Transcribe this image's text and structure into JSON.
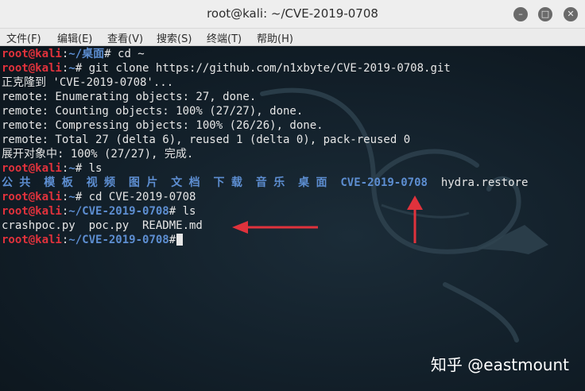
{
  "window": {
    "title": "root@kali: ~/CVE-2019-0708"
  },
  "menu": [
    "文件(F)",
    "编辑(E)",
    "查看(V)",
    "搜索(S)",
    "终端(T)",
    "帮助(H)"
  ],
  "prompt": {
    "user": "root@kali",
    "sep": ":",
    "hash": "#"
  },
  "lines": [
    {
      "path": "~/桌面",
      "cmd": " cd ~"
    },
    {
      "path": "~",
      "cmd": " git clone https://github.com/n1xbyte/CVE-2019-0708.git"
    },
    {
      "out": "正克隆到 'CVE-2019-0708'..."
    },
    {
      "out": "remote: Enumerating objects: 27, done."
    },
    {
      "out": "remote: Counting objects: 100% (27/27), done."
    },
    {
      "out": "remote: Compressing objects: 100% (26/26), done."
    },
    {
      "out": "remote: Total 27 (delta 6), reused 1 (delta 0), pack-reused 0"
    },
    {
      "out": "展开对象中: 100% (27/27), 完成."
    },
    {
      "path": "~",
      "cmd": " ls"
    },
    {
      "dirs": [
        "公共",
        "模板",
        "视频",
        "图片",
        "文档",
        "下载",
        "音乐",
        "桌面",
        "CVE-2019-0708"
      ],
      "file": "hydra.restore"
    },
    {
      "path": "~",
      "cmd": " cd CVE-2019-0708"
    },
    {
      "path": "~/CVE-2019-0708",
      "cmd": " ls"
    },
    {
      "out": "crashpoc.py  poc.py  README.md"
    },
    {
      "path": "~/CVE-2019-0708",
      "cmd": ""
    }
  ],
  "watermark": "知乎 @eastmount",
  "colors": {
    "user": "#e0323c",
    "path": "#5d8ed1",
    "arrow": "#e0323c"
  }
}
